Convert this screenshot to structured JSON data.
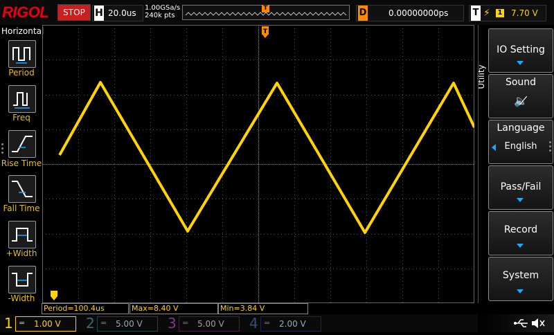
{
  "brand": "RIGOL",
  "run_state": "STOP",
  "horizontal": {
    "letter": "H",
    "timebase": "20.0us"
  },
  "acquisition": {
    "sample_rate": "1.00GSa/s",
    "memory_depth": "240k pts"
  },
  "trigger_pos_marker": "T",
  "delay": {
    "letter": "D",
    "value": "0.00000000ps"
  },
  "trigger": {
    "letter": "T",
    "edge_symbol": "⚡",
    "source": "1",
    "level": "7.70 V"
  },
  "left_menu": {
    "title": "Horizontal",
    "items": [
      {
        "label": "Period",
        "icon": "period-icon"
      },
      {
        "label": "Freq",
        "icon": "freq-icon"
      },
      {
        "label": "Rise Time",
        "icon": "rise-time-icon"
      },
      {
        "label": "Fall Time",
        "icon": "fall-time-icon"
      },
      {
        "label": "+Width",
        "icon": "positive-width-icon"
      },
      {
        "label": "-Width",
        "icon": "negative-width-icon"
      }
    ]
  },
  "right_menu": {
    "title": "Utility",
    "items": [
      {
        "label": "IO Setting",
        "sub": ""
      },
      {
        "label": "Sound",
        "sub": "🔈̸"
      },
      {
        "label": "Language",
        "sub": "English"
      },
      {
        "label": "Pass/Fail",
        "sub": ""
      },
      {
        "label": "Record",
        "sub": ""
      },
      {
        "label": "System",
        "sub": ""
      }
    ]
  },
  "measurements": [
    {
      "label": "Period",
      "value": "100.4us"
    },
    {
      "label": "Max",
      "value": "8.40 V"
    },
    {
      "label": "Min",
      "value": "3.84 V"
    }
  ],
  "channels": [
    {
      "num": "1",
      "coupling": "=",
      "scale": "1.00 V",
      "color": "#ffd400",
      "active": true
    },
    {
      "num": "2",
      "coupling": "=",
      "scale": "5.00 V",
      "color": "#00c8c8",
      "active": false
    },
    {
      "num": "3",
      "coupling": "=",
      "scale": "5.00 V",
      "color": "#e000e0",
      "active": false
    },
    {
      "num": "4",
      "coupling": "=",
      "scale": "2.00 V",
      "color": "#1e6fff",
      "active": false
    }
  ],
  "colors": {
    "ch1": "#ffd400",
    "trigger": "#ff8a00",
    "accent": "#1ea7ff"
  }
}
